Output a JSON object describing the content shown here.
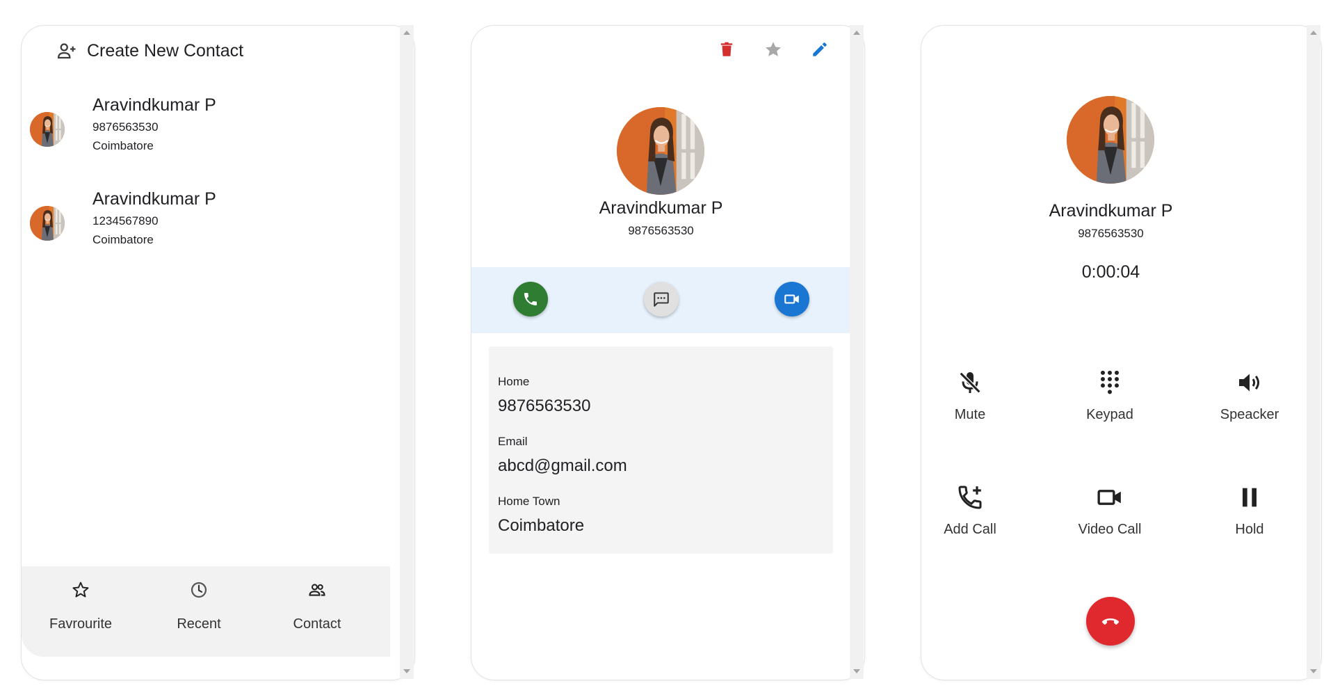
{
  "list_screen": {
    "create_label": "Create New Contact",
    "contacts": [
      {
        "name": "Aravindkumar P",
        "phone": "9876563530",
        "city": "Coimbatore"
      },
      {
        "name": "Aravindkumar P",
        "phone": "1234567890",
        "city": "Coimbatore"
      }
    ],
    "nav": [
      {
        "label": "Favrourite",
        "icon": "star-outline-icon"
      },
      {
        "label": "Recent",
        "icon": "clock-icon"
      },
      {
        "label": "Contact",
        "icon": "people-icon"
      }
    ]
  },
  "detail_screen": {
    "actions": {
      "delete": "delete-icon",
      "favourite": "star-icon",
      "edit": "pencil-icon"
    },
    "name": "Aravindkumar P",
    "phone": "9876563530",
    "fields": [
      {
        "label": "Home",
        "value": "9876563530"
      },
      {
        "label": "Email",
        "value": "abcd@gmail.com"
      },
      {
        "label": "Home Town",
        "value": "Coimbatore"
      }
    ],
    "colors": {
      "call": "#2e7d32",
      "message": "#e0e0e0",
      "video": "#1976d2",
      "delete": "#d32f2f",
      "edit": "#1976d2",
      "band": "#e8f2fc"
    }
  },
  "call_screen": {
    "name": "Aravindkumar P",
    "phone": "9876563530",
    "timer": "0:00:04",
    "controls": [
      {
        "label": "Mute",
        "icon": "mic-off-icon"
      },
      {
        "label": "Keypad",
        "icon": "dialpad-icon"
      },
      {
        "label": "Speacker",
        "icon": "speaker-icon"
      },
      {
        "label": "Add Call",
        "icon": "add-call-icon"
      },
      {
        "label": "Video Call",
        "icon": "videocam-icon"
      },
      {
        "label": "Hold",
        "icon": "pause-icon"
      }
    ],
    "hangup_color": "#e0292f"
  }
}
